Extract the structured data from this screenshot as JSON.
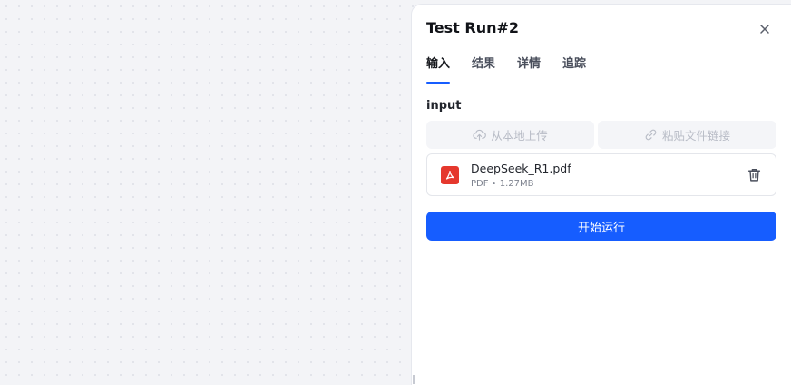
{
  "panel": {
    "title": "Test Run#2",
    "tabs": [
      {
        "label": "输入",
        "active": true
      },
      {
        "label": "结果",
        "active": false
      },
      {
        "label": "详情",
        "active": false
      },
      {
        "label": "追踪",
        "active": false
      }
    ]
  },
  "input": {
    "label": "input",
    "upload_local_label": "从本地上传",
    "paste_link_label": "粘贴文件链接",
    "file": {
      "name": "DeepSeek_R1.pdf",
      "type": "PDF",
      "size": "1.27MB",
      "meta": "PDF • 1.27MB",
      "icon": "pdf-file-icon"
    }
  },
  "actions": {
    "run_label": "开始运行"
  },
  "colors": {
    "accent": "#165dff",
    "pdf": "#e5382d"
  }
}
